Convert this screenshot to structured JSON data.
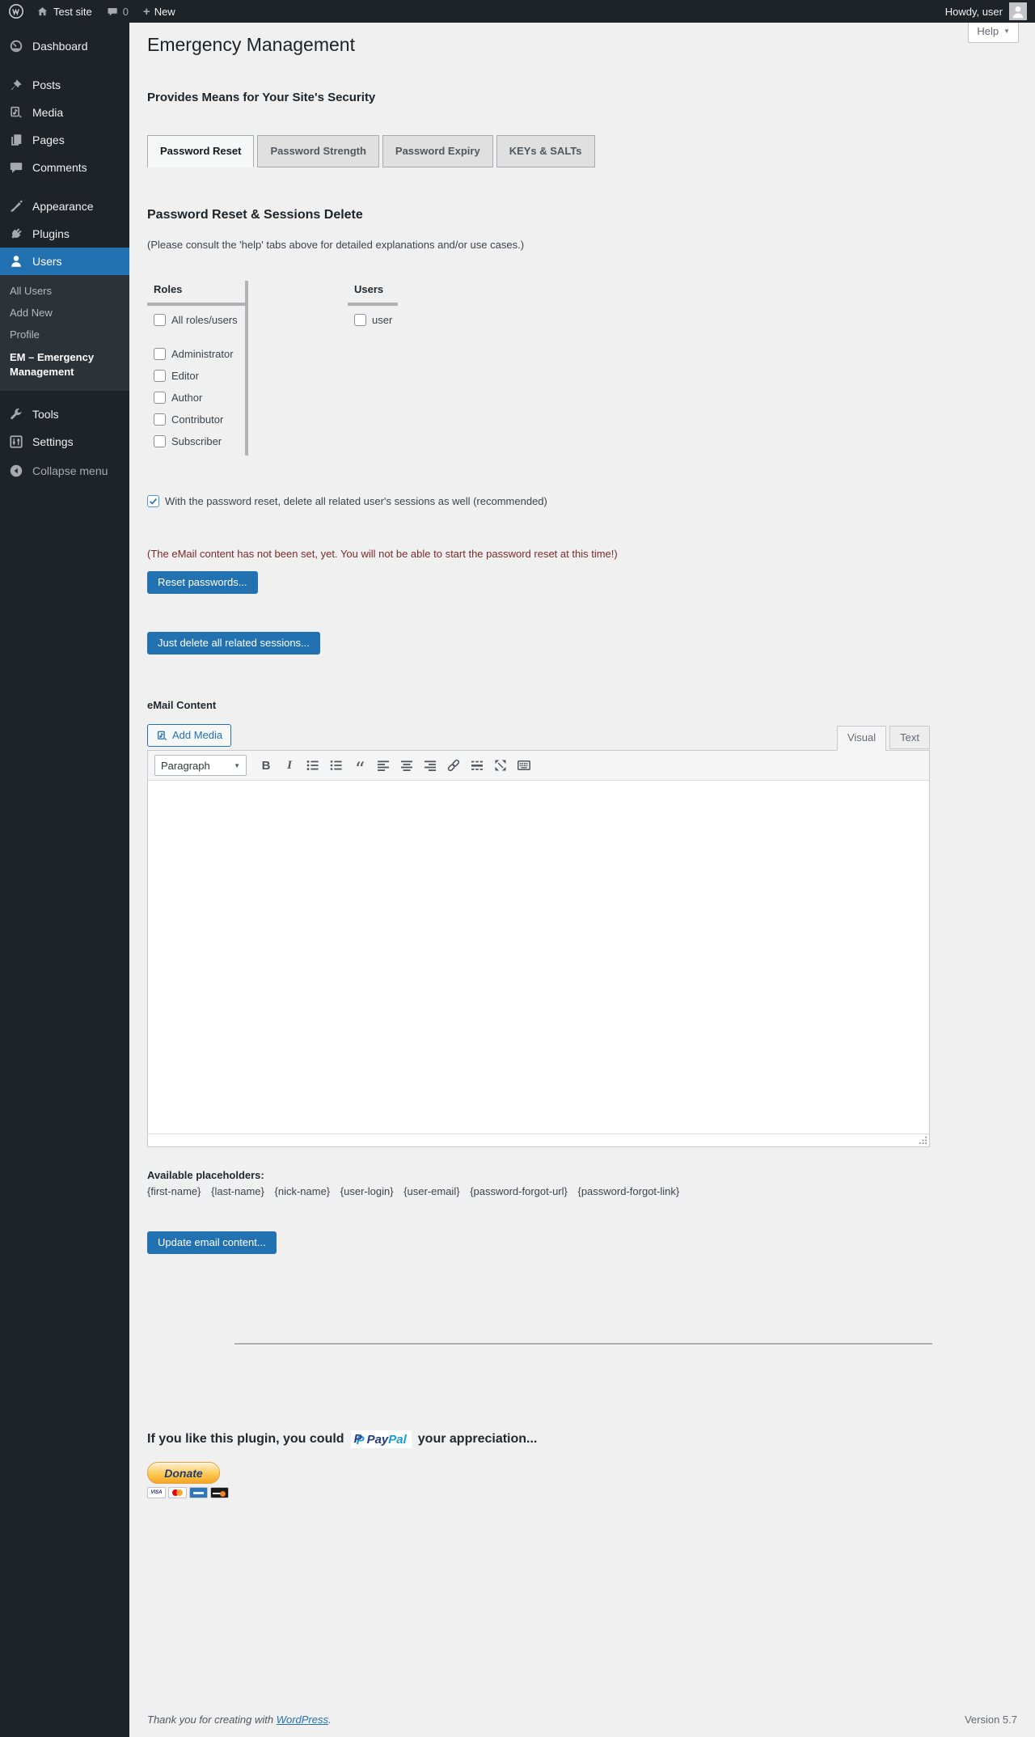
{
  "admin_bar": {
    "site_name": "Test site",
    "comments_count": "0",
    "new_label": "New",
    "howdy_text": "Howdy, user"
  },
  "sidebar": {
    "items": [
      {
        "label": "Dashboard"
      },
      {
        "label": "Posts"
      },
      {
        "label": "Media"
      },
      {
        "label": "Pages"
      },
      {
        "label": "Comments"
      },
      {
        "label": "Appearance"
      },
      {
        "label": "Plugins"
      },
      {
        "label": "Users"
      },
      {
        "label": "Tools"
      },
      {
        "label": "Settings"
      }
    ],
    "users_submenu": {
      "all_users": "All Users",
      "add_new": "Add New",
      "profile": "Profile",
      "em": "EM – Emergency Management"
    },
    "collapse_label": "Collapse menu"
  },
  "page": {
    "title": "Emergency Management",
    "help_label": "Help",
    "subtitle": "Provides Means for Your Site's Security",
    "tabs": [
      {
        "label": "Password Reset",
        "active": true
      },
      {
        "label": "Password Strength",
        "active": false
      },
      {
        "label": "Password Expiry",
        "active": false
      },
      {
        "label": "KEYs & SALTs",
        "active": false
      }
    ],
    "section_title": "Password Reset & Sessions Delete",
    "section_note": "(Please consult the 'help' tabs above for detailed explanations and/or use cases.)",
    "selector": {
      "roles_header": "Roles",
      "users_header": "Users",
      "roles": [
        {
          "label": "All roles/users",
          "checked": false
        },
        {
          "label": "Administrator",
          "checked": false
        },
        {
          "label": "Editor",
          "checked": false
        },
        {
          "label": "Author",
          "checked": false
        },
        {
          "label": "Contributor",
          "checked": false
        },
        {
          "label": "Subscriber",
          "checked": false
        }
      ],
      "users": [
        {
          "label": "user",
          "checked": false
        }
      ]
    },
    "sessions_checkbox": {
      "label": "With the password reset, delete all related user's sessions as well (recommended)",
      "checked": true
    },
    "warning": "(The eMail content has not been set, yet. You will not be able to start the password reset at this time!)",
    "reset_button": "Reset passwords...",
    "delete_sessions_button": "Just delete all related sessions...",
    "email_section": {
      "label": "eMail Content",
      "add_media": "Add Media",
      "visual_tab": "Visual",
      "text_tab": "Text",
      "paragraph_dropdown": "Paragraph",
      "editor_text": ""
    },
    "placeholders_label": "Available placeholders:",
    "placeholders": [
      "{first-name}",
      "{last-name}",
      "{nick-name}",
      "{user-login}",
      "{user-email}",
      "{password-forgot-url}",
      "{password-forgot-link}"
    ],
    "update_button": "Update email content...",
    "donate": {
      "prefix": "If you like this plugin, you could",
      "paypal_word_dark": "Pay",
      "paypal_word_light": "Pal",
      "suffix": "your appreciation...",
      "donate_button": "Donate",
      "card_visa": "VISA"
    }
  },
  "footer": {
    "thanks_prefix": "Thank you for creating with",
    "wordpress_link": "WordPress",
    "suffix": ".",
    "version": "Version 5.7"
  },
  "colors": {
    "accent": "#2271b1",
    "admin_bar_bg": "#1d2327",
    "submenu_bg": "#2c3338",
    "page_bg": "#f0f0f1",
    "warning_text": "#7b2b2b"
  }
}
